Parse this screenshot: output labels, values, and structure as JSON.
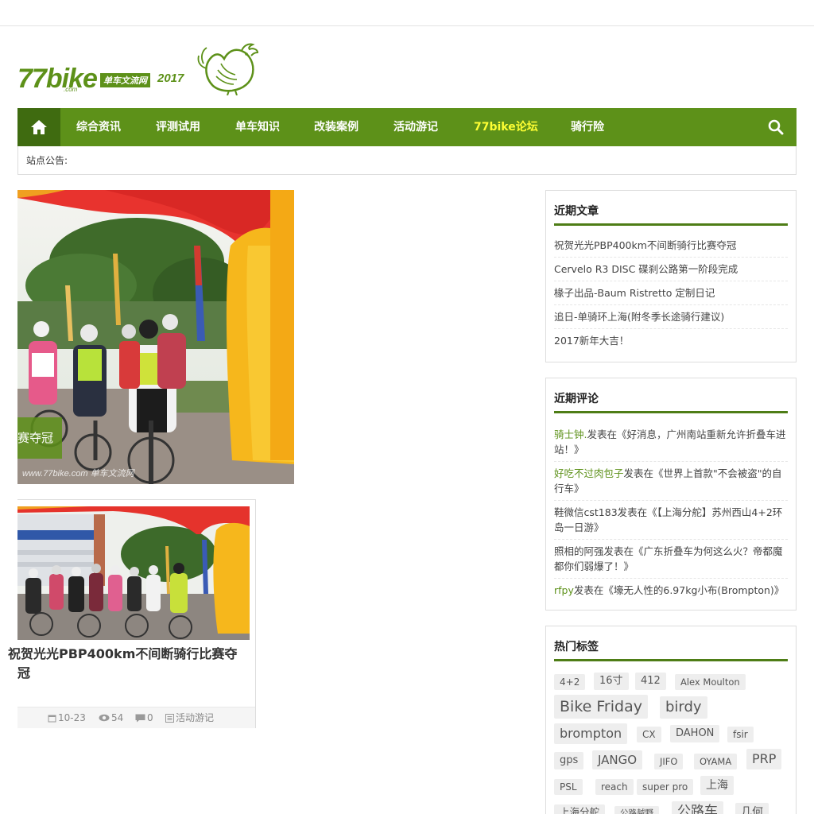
{
  "site": {
    "logo_text": "77bike",
    "logo_com": ".com",
    "logo_badge": "单车文流网",
    "logo_year": "2017",
    "logo_mascot": "rooster-icon"
  },
  "nav": {
    "home_icon": "home-icon",
    "items": [
      {
        "label": "综合资讯"
      },
      {
        "label": "评测试用"
      },
      {
        "label": "单车知识"
      },
      {
        "label": "改装案例"
      },
      {
        "label": "活动游记"
      },
      {
        "label": "77bike论坛",
        "highlight": true
      },
      {
        "label": "骑行险"
      }
    ],
    "search_icon": "search-icon"
  },
  "notice": {
    "label": "站点公告:"
  },
  "posts": [
    {
      "title_partial": "赛夺冠",
      "watermark": "www.77bike.com 单车文流网"
    },
    {
      "title": "祝贺光光PBP400km不间断骑行比赛夺冠",
      "date": "10-23",
      "views": "54",
      "comments": "0",
      "category": "活动游记"
    }
  ],
  "sidebar": {
    "recent_posts": {
      "title": "近期文章",
      "items": [
        "祝贺光光PBP400km不间断骑行比赛夺冠",
        "Cervelo R3 DISC 碟刹公路第一阶段完成",
        "椽子出品-Baum Ristretto 定制日记",
        "追日-单骑环上海(附冬季长途骑行建议)",
        "2017新年大吉！"
      ]
    },
    "recent_comments": {
      "title": "近期评论",
      "items": [
        {
          "author": "骑士钟.",
          "text": "发表在《好消息，广州南站重新允许折叠车进站！》",
          "author_linked": true
        },
        {
          "author": "好吃不过肉包子",
          "text": "发表在《世界上首款\"不会被盗\"的自行车》",
          "author_linked": true
        },
        {
          "author": "鞋微信cst183",
          "text": "发表在《【上海分舵】苏州西山4+2环岛一日游》",
          "author_linked": false
        },
        {
          "author": "照相的阿强",
          "text": "发表在《广东折叠车为何这么火？帝都魔都你们弱爆了！》",
          "author_linked": false
        },
        {
          "author": "rfpy",
          "text": "发表在《壕无人性的6.97kg小布(Brompton)》",
          "author_linked": true
        }
      ]
    },
    "hot_tags": {
      "title": "热门标签",
      "items": [
        "4+2",
        "16寸",
        "412",
        "Alex Moulton",
        "Bike Friday",
        "birdy",
        "brompton",
        "CX",
        "DAHON",
        "fsir",
        "gps",
        "JANGO",
        "JIFO",
        "OYAMA",
        "PRP",
        "PSL",
        "reach",
        "super pro",
        "上海",
        "上海分舵",
        "公路越野",
        "公路车",
        "几何"
      ]
    }
  },
  "colors": {
    "brand_green": "#5d9119",
    "nav_home_dark": "#3f6b10",
    "highlight_yellow": "#ffff33",
    "title_underline": "#4e7d16"
  }
}
